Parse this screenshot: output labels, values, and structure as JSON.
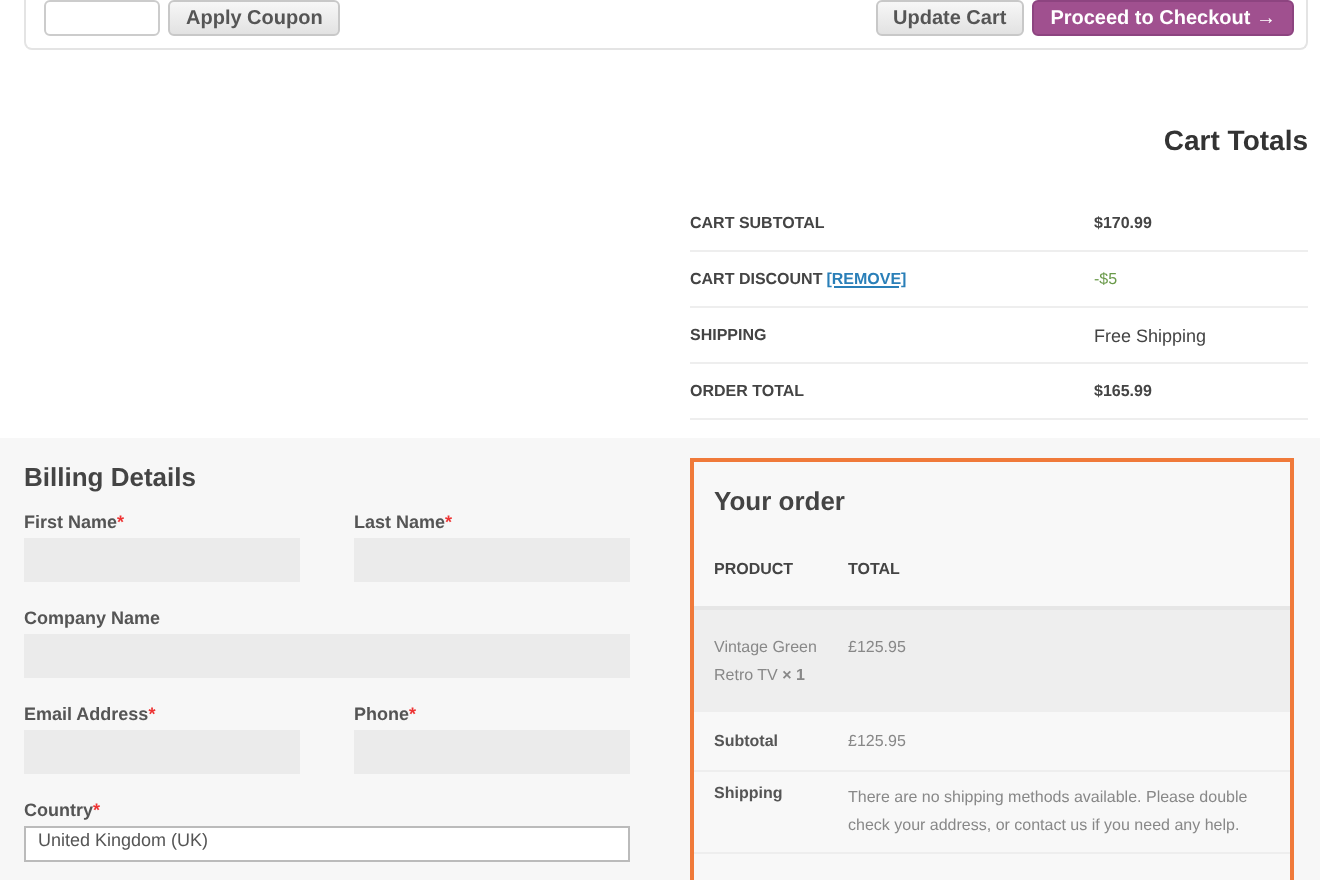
{
  "coupon": {
    "apply_button": "Apply Coupon",
    "update_button": "Update Cart",
    "checkout_button": "Proceed to Checkout →"
  },
  "cart_totals": {
    "title": "Cart Totals",
    "rows": [
      {
        "label": "CART SUBTOTAL",
        "link": "",
        "value": "$170.99",
        "kind": "plain"
      },
      {
        "label": "CART DISCOUNT",
        "link": "[REMOVE]",
        "value": "-$5",
        "kind": "discount"
      },
      {
        "label": "SHIPPING",
        "link": "",
        "value": "Free Shipping",
        "kind": "light"
      },
      {
        "label": "ORDER TOTAL",
        "link": "",
        "value": "$165.99",
        "kind": "plain"
      }
    ]
  },
  "billing": {
    "title": "Billing Details",
    "fields": [
      {
        "label": "First Name",
        "marker": "*",
        "wide": false
      },
      {
        "label": "Last Name",
        "marker": "*",
        "wide": false
      },
      {
        "label": "Company Name",
        "wide": true
      },
      {
        "label": "Email Address",
        "marker": "*",
        "wide": false
      },
      {
        "label": "Phone",
        "marker": "*",
        "wide": false
      }
    ],
    "country": {
      "label": "Country",
      "marker": "*",
      "value": "United Kingdom (UK)"
    }
  },
  "order": {
    "title": "Your order",
    "columns": [
      "PRODUCT",
      "TOTAL"
    ],
    "items": [
      {
        "product": "Vintage Green Retro TV **× 1**",
        "total": "£125.95"
      }
    ],
    "subtotal": {
      "label": "Subtotal",
      "value": "£125.95"
    },
    "shipping": {
      "label": "Shipping",
      "value": "There are no shipping methods available. Please double check your address, or contact us if you need any help."
    }
  }
}
